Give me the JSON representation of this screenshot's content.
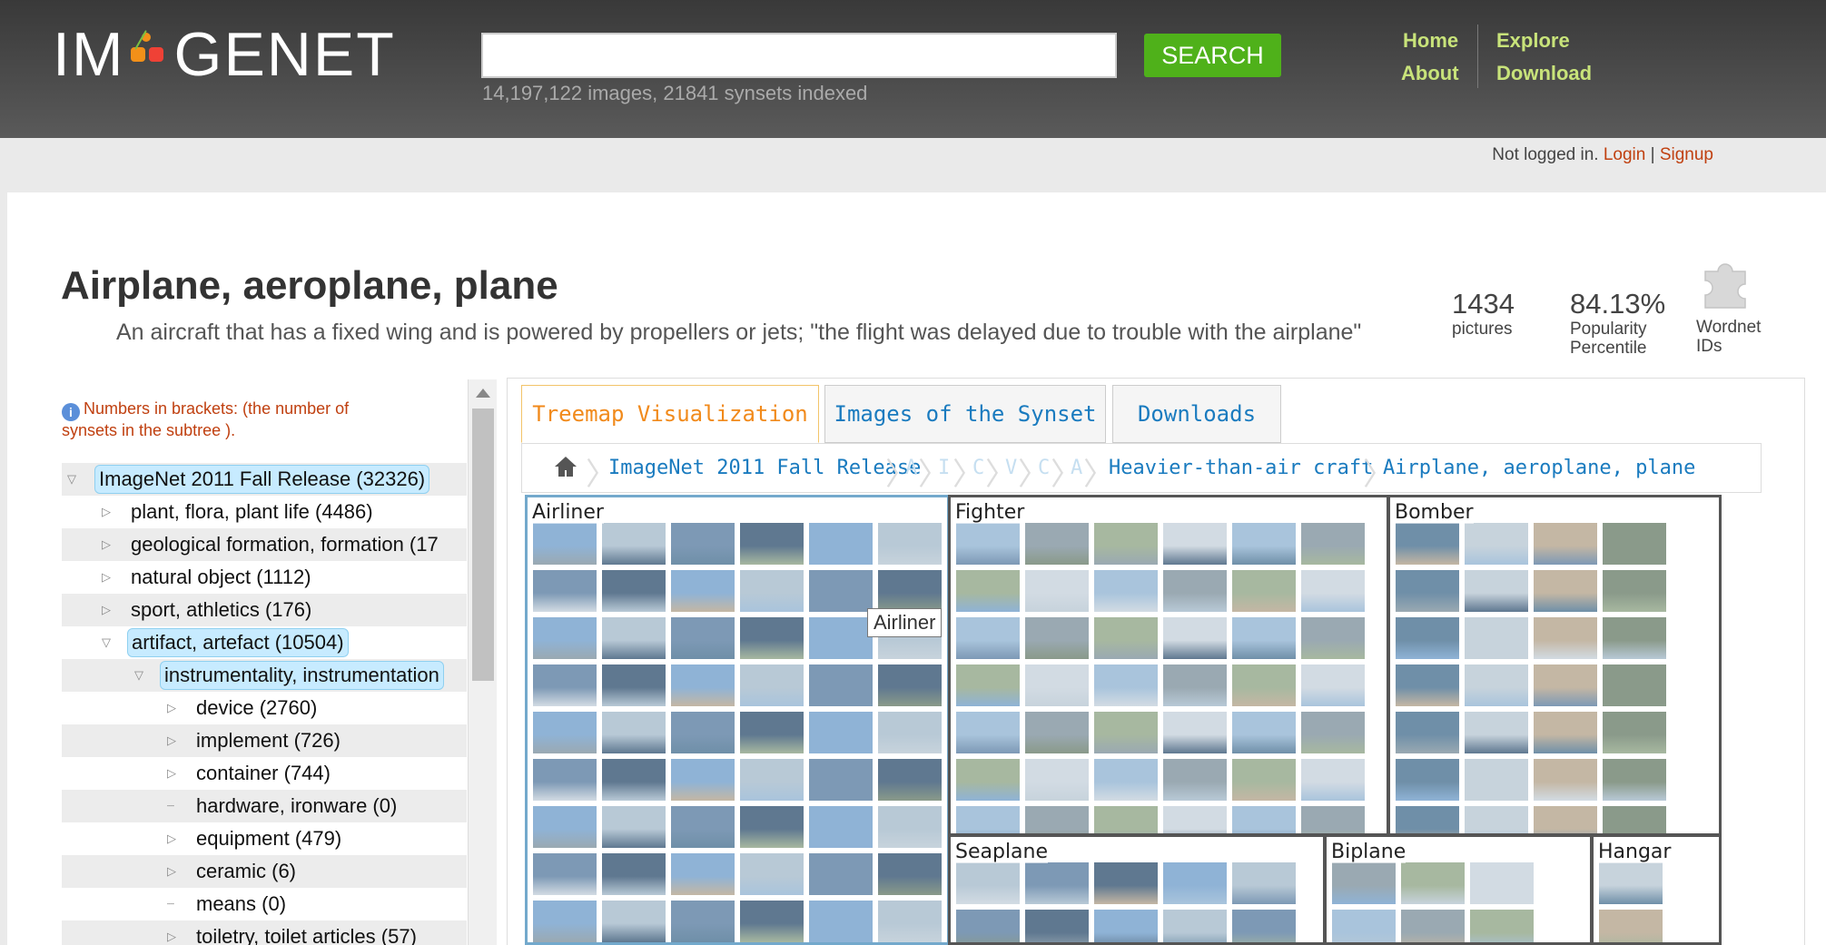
{
  "header": {
    "logo_left": "IM",
    "logo_right": "GENET",
    "logo_dot_colors": [
      "#f39019",
      "#ef4136",
      "#7ac142"
    ],
    "search_value": "",
    "search_button": "SEARCH",
    "stats": "14,197,122 images, 21841 synsets indexed",
    "nav": {
      "home": "Home",
      "about": "About",
      "explore": "Explore",
      "download": "Download"
    }
  },
  "login": {
    "status": "Not logged in.",
    "login": "Login",
    "separator": "|",
    "signup": "Signup"
  },
  "synset": {
    "title": "Airplane, aeroplane, plane",
    "gloss": "An aircraft that has a fixed wing and is powered by propellers or jets; \"the flight was delayed due to trouble with the airplane\"",
    "pictures_count": "1434",
    "pictures_label": "pictures",
    "popularity_value": "84.13%",
    "popularity_label_1": "Popularity",
    "popularity_label_2": "Percentile",
    "wordnet_label_1": "Wordnet",
    "wordnet_label_2": "IDs",
    "wordnet_icon": "puzzle-piece-icon"
  },
  "sidebar": {
    "info_icon": "i",
    "note": "Numbers in brackets: (the number of synsets in the subtree ).",
    "tree": [
      {
        "label": "ImageNet 2011 Fall Release (32326)",
        "selected": true
      },
      {
        "label": "plant, flora, plant life (4486)",
        "selected": false
      },
      {
        "label": "geological formation, formation (17",
        "selected": false
      },
      {
        "label": "natural object (1112)",
        "selected": false
      },
      {
        "label": "sport, athletics (176)",
        "selected": false
      },
      {
        "label": "artifact, artefact (10504)",
        "selected": true
      },
      {
        "label": "instrumentality, instrumentation",
        "selected": true
      },
      {
        "label": "device (2760)",
        "selected": false
      },
      {
        "label": "implement (726)",
        "selected": false
      },
      {
        "label": "container (744)",
        "selected": false
      },
      {
        "label": "hardware, ironware (0)",
        "selected": false
      },
      {
        "label": "equipment (479)",
        "selected": false
      },
      {
        "label": "ceramic (6)",
        "selected": false
      },
      {
        "label": "means (0)",
        "selected": false
      },
      {
        "label": "toiletry, toilet articles (57)",
        "selected": false
      }
    ]
  },
  "tabs": {
    "treemap": "Treemap Visualization",
    "images": "Images of the Synset",
    "downloads": "Downloads"
  },
  "breadcrumb": {
    "home_icon": "home-icon",
    "root": "ImageNet 2011 Fall Release",
    "truncated": [
      "A",
      "I",
      "C",
      "V",
      "C",
      "A"
    ],
    "heavier": "Heavier-than-air craft",
    "current": "Airplane, aeroplane, plane"
  },
  "treemap": {
    "airliner": "Airliner",
    "fighter": "Fighter",
    "bomber": "Bomber",
    "seaplane": "Seaplane",
    "biplane": "Biplane",
    "hangar": "Hangar"
  },
  "tooltip": "Airliner",
  "colors": {
    "accent_green": "#4fb11a",
    "nav_green": "#c8e37a",
    "link_blue": "#1a7bbf",
    "tab_orange": "#f18a1b",
    "alert_red": "#c04010"
  }
}
